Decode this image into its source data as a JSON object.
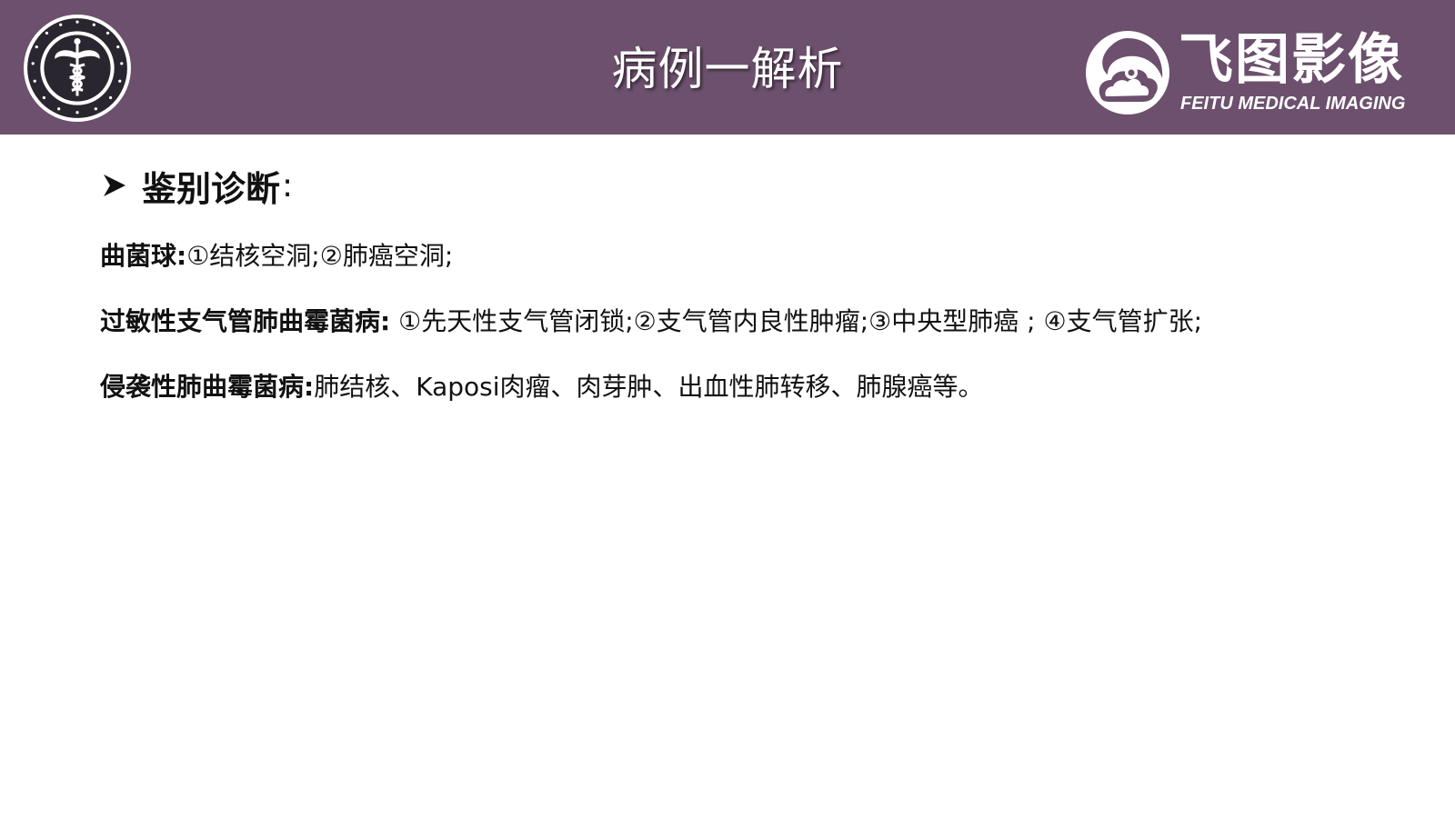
{
  "header": {
    "title": "病例一解析",
    "background_color": "#6c506d",
    "emblem_icon": "caduceus-emblem-icon",
    "brand": {
      "name_cn": "飞图影像",
      "name_en": "FEITU MEDICAL IMAGING",
      "icon": "cloud-swirl-logo-icon"
    }
  },
  "content": {
    "heading": {
      "bullet_icon": "arrow-bullet-icon",
      "text": "鉴别诊断",
      "colon": ":"
    },
    "items": [
      {
        "label": "曲菌球:",
        "text": "①结核空洞;②肺癌空洞;"
      },
      {
        "label": "过敏性支气管肺曲霉菌病:",
        "text": " ①先天性支气管闭锁;②支气管内良性肿瘤;③中央型肺癌 ; ④支气管扩张;"
      },
      {
        "label": "侵袭性肺曲霉菌病:",
        "text": "肺结核、Kaposi肉瘤、肉芽肿、出血性肺转移、肺腺癌等。"
      }
    ]
  }
}
